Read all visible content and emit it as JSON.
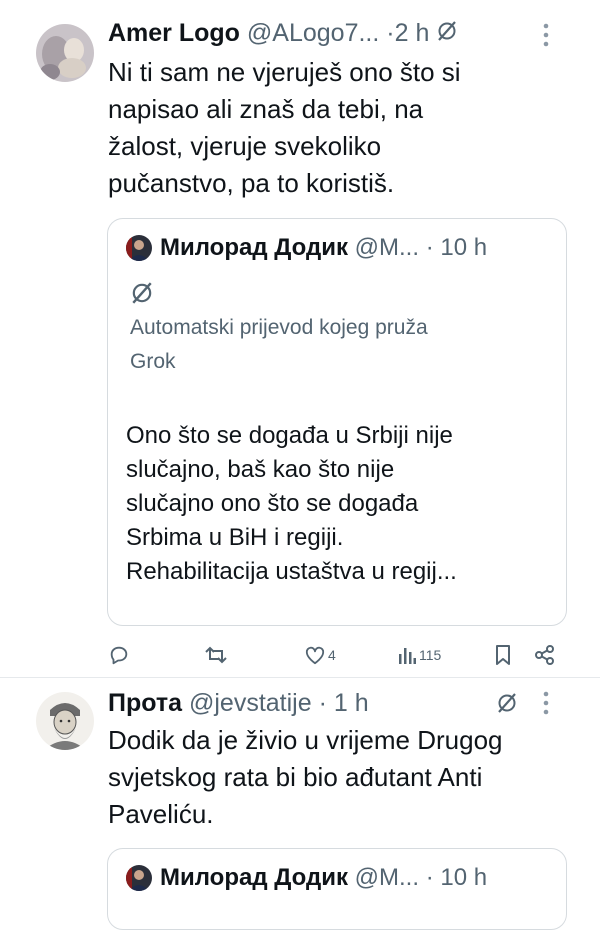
{
  "tweet1": {
    "name": "Amer Logo",
    "handle": "@ALogo7...",
    "time": "2 h",
    "separator": "·",
    "more_icon": "more-dots-icon",
    "text_lines": [
      "Ni ti sam ne vjeruješ ono što si",
      "napisao ali znaš da tebi, na",
      "žalost, vjeruje svekoliko",
      "pučanstvo, pa to koristiš."
    ],
    "quote": {
      "name": "Милорад Додик",
      "handle": "@M...",
      "time": "10 h",
      "translation_label_lines": [
        "Automatski prijevod kojeg pruža",
        "Grok"
      ],
      "text_lines": [
        "Ono što se događa u Srbiji nije",
        "slučajno, baš kao što nije",
        "slučajno ono što se događa",
        "Srbima u BiH i regiji.",
        "Rehabilitacija ustaštva u regij..."
      ]
    },
    "actions": {
      "reply_count": "",
      "retweet_count": "",
      "like_count": "4",
      "views_count": "115"
    }
  },
  "tweet2": {
    "name": "Прота",
    "handle": "@jevstatije",
    "time": "1 h",
    "separator": "·",
    "text_lines": [
      "Dodik da je živio u vrijeme Drugog",
      "svjetskog rata bi bio ađutant Anti",
      "Paveliću."
    ],
    "quote": {
      "name": "Милорад Додик",
      "handle": "@M...",
      "time": "10 h"
    }
  },
  "colors": {
    "text": "#0f1419",
    "secondary": "#536471",
    "border": "#d6dbdf"
  }
}
